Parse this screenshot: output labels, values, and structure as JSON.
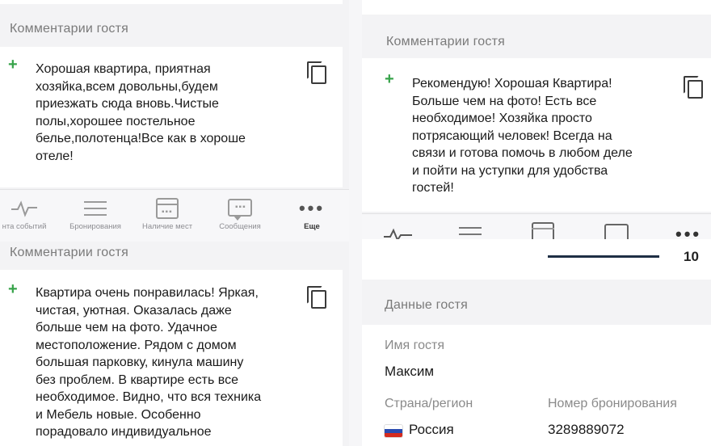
{
  "left": {
    "top_section_title": "Комментарии гостя",
    "comment_1": "Хорошая квартира, приятная\nхозяйка,всем довольны,будем\nприезжать сюда вновь.Чистые\nполы,хорошее постельное\nбелье,полотенца!Все как в хороше\nотеле!",
    "tabbar": [
      {
        "label": "нта событий",
        "icon": "activity-icon"
      },
      {
        "label": "Бронирования",
        "icon": "list-icon"
      },
      {
        "label": "Наличие мест",
        "icon": "calendar-icon"
      },
      {
        "label": "Сообщения",
        "icon": "message-icon"
      },
      {
        "label": "Еще",
        "icon": "more-icon"
      }
    ],
    "bottom_section_title": "Комментарии гостя",
    "comment_2": "Квартира очень понравилась! Яркая,\nчистая, уютная. Оказалась даже\nбольше чем на фото. Удачное\nместоположение. Рядом с домом\nбольшая парковку, кинула машину\nбез проблем. В квартире есть все\nнеобходимое. Видно, что вся техника\nи Мебель новые. Особенно\nпорадовало индивидуальное"
  },
  "right": {
    "section_title": "Комментарии гостя",
    "comment": "Рекомендую! Хорошая Квартира!\nБольше чем на фото! Есть все\nнеобходимое! Хозяйка просто\nпотрясающий человек! Всегда на\nсвязи и готова помочь в любом деле\nи пойти на уступки для удобства\nгостей!",
    "progress_value": "10",
    "guest_section_title": "Данные гостя",
    "guest_name_label": "Имя гостя",
    "guest_name": "Максим",
    "country_label": "Страна/регион",
    "country": "Россия",
    "booking_number_label": "Номер бронирования",
    "booking_number": "3289889072"
  },
  "colors": {
    "plus_green": "#37a34a",
    "background": "#f3f3f5",
    "card": "#ffffff"
  }
}
